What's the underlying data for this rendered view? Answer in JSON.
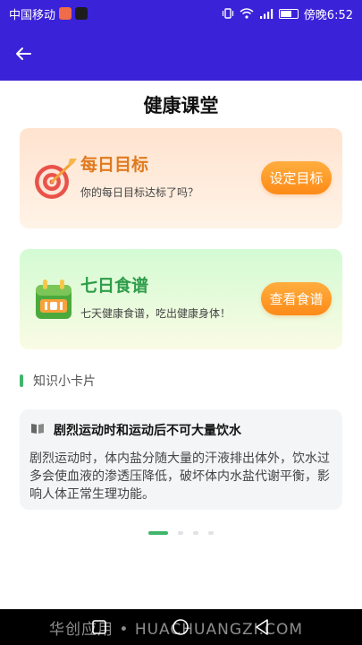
{
  "status_bar": {
    "carrier": "中国移动",
    "time": "傍晚6:52",
    "colors": {
      "background": "#3a22d8"
    }
  },
  "app_bar": {
    "back_icon": "arrow-left-icon",
    "color": "#3a22d8"
  },
  "page": {
    "title": "健康课堂"
  },
  "cards": [
    {
      "title": "每日目标",
      "subtitle": "你的每日目标达标了吗？",
      "button": "设定目标",
      "icon": "target-dart-icon",
      "title_color": "#e07a1e"
    },
    {
      "title": "七日食谱",
      "subtitle": "七天健康食谱，吃出健康身体！",
      "button": "查看食谱",
      "icon": "calendar-icon",
      "title_color": "#2f9d4a"
    }
  ],
  "knowledge": {
    "section_label": "知识小卡片",
    "tip": {
      "icon": "book-icon",
      "title": "剧烈运动时和运动后不可大量饮水",
      "body": "剧烈运动时，体内盐分随大量的汗液排出体外，饮水过多会使血液的渗透压降低，破坏体内水盐代谢平衡，影响人体正常生理功能。"
    },
    "carousel": {
      "count": 4,
      "active_index": 0
    }
  },
  "nav_bar": {
    "watermark": "华创应用 • HUACHUANGZI.COM",
    "icons": [
      "square-icon",
      "circle-icon",
      "triangle-back-icon"
    ]
  },
  "accent_colors": {
    "orange": "#fd8a17",
    "green": "#3fb56a"
  }
}
